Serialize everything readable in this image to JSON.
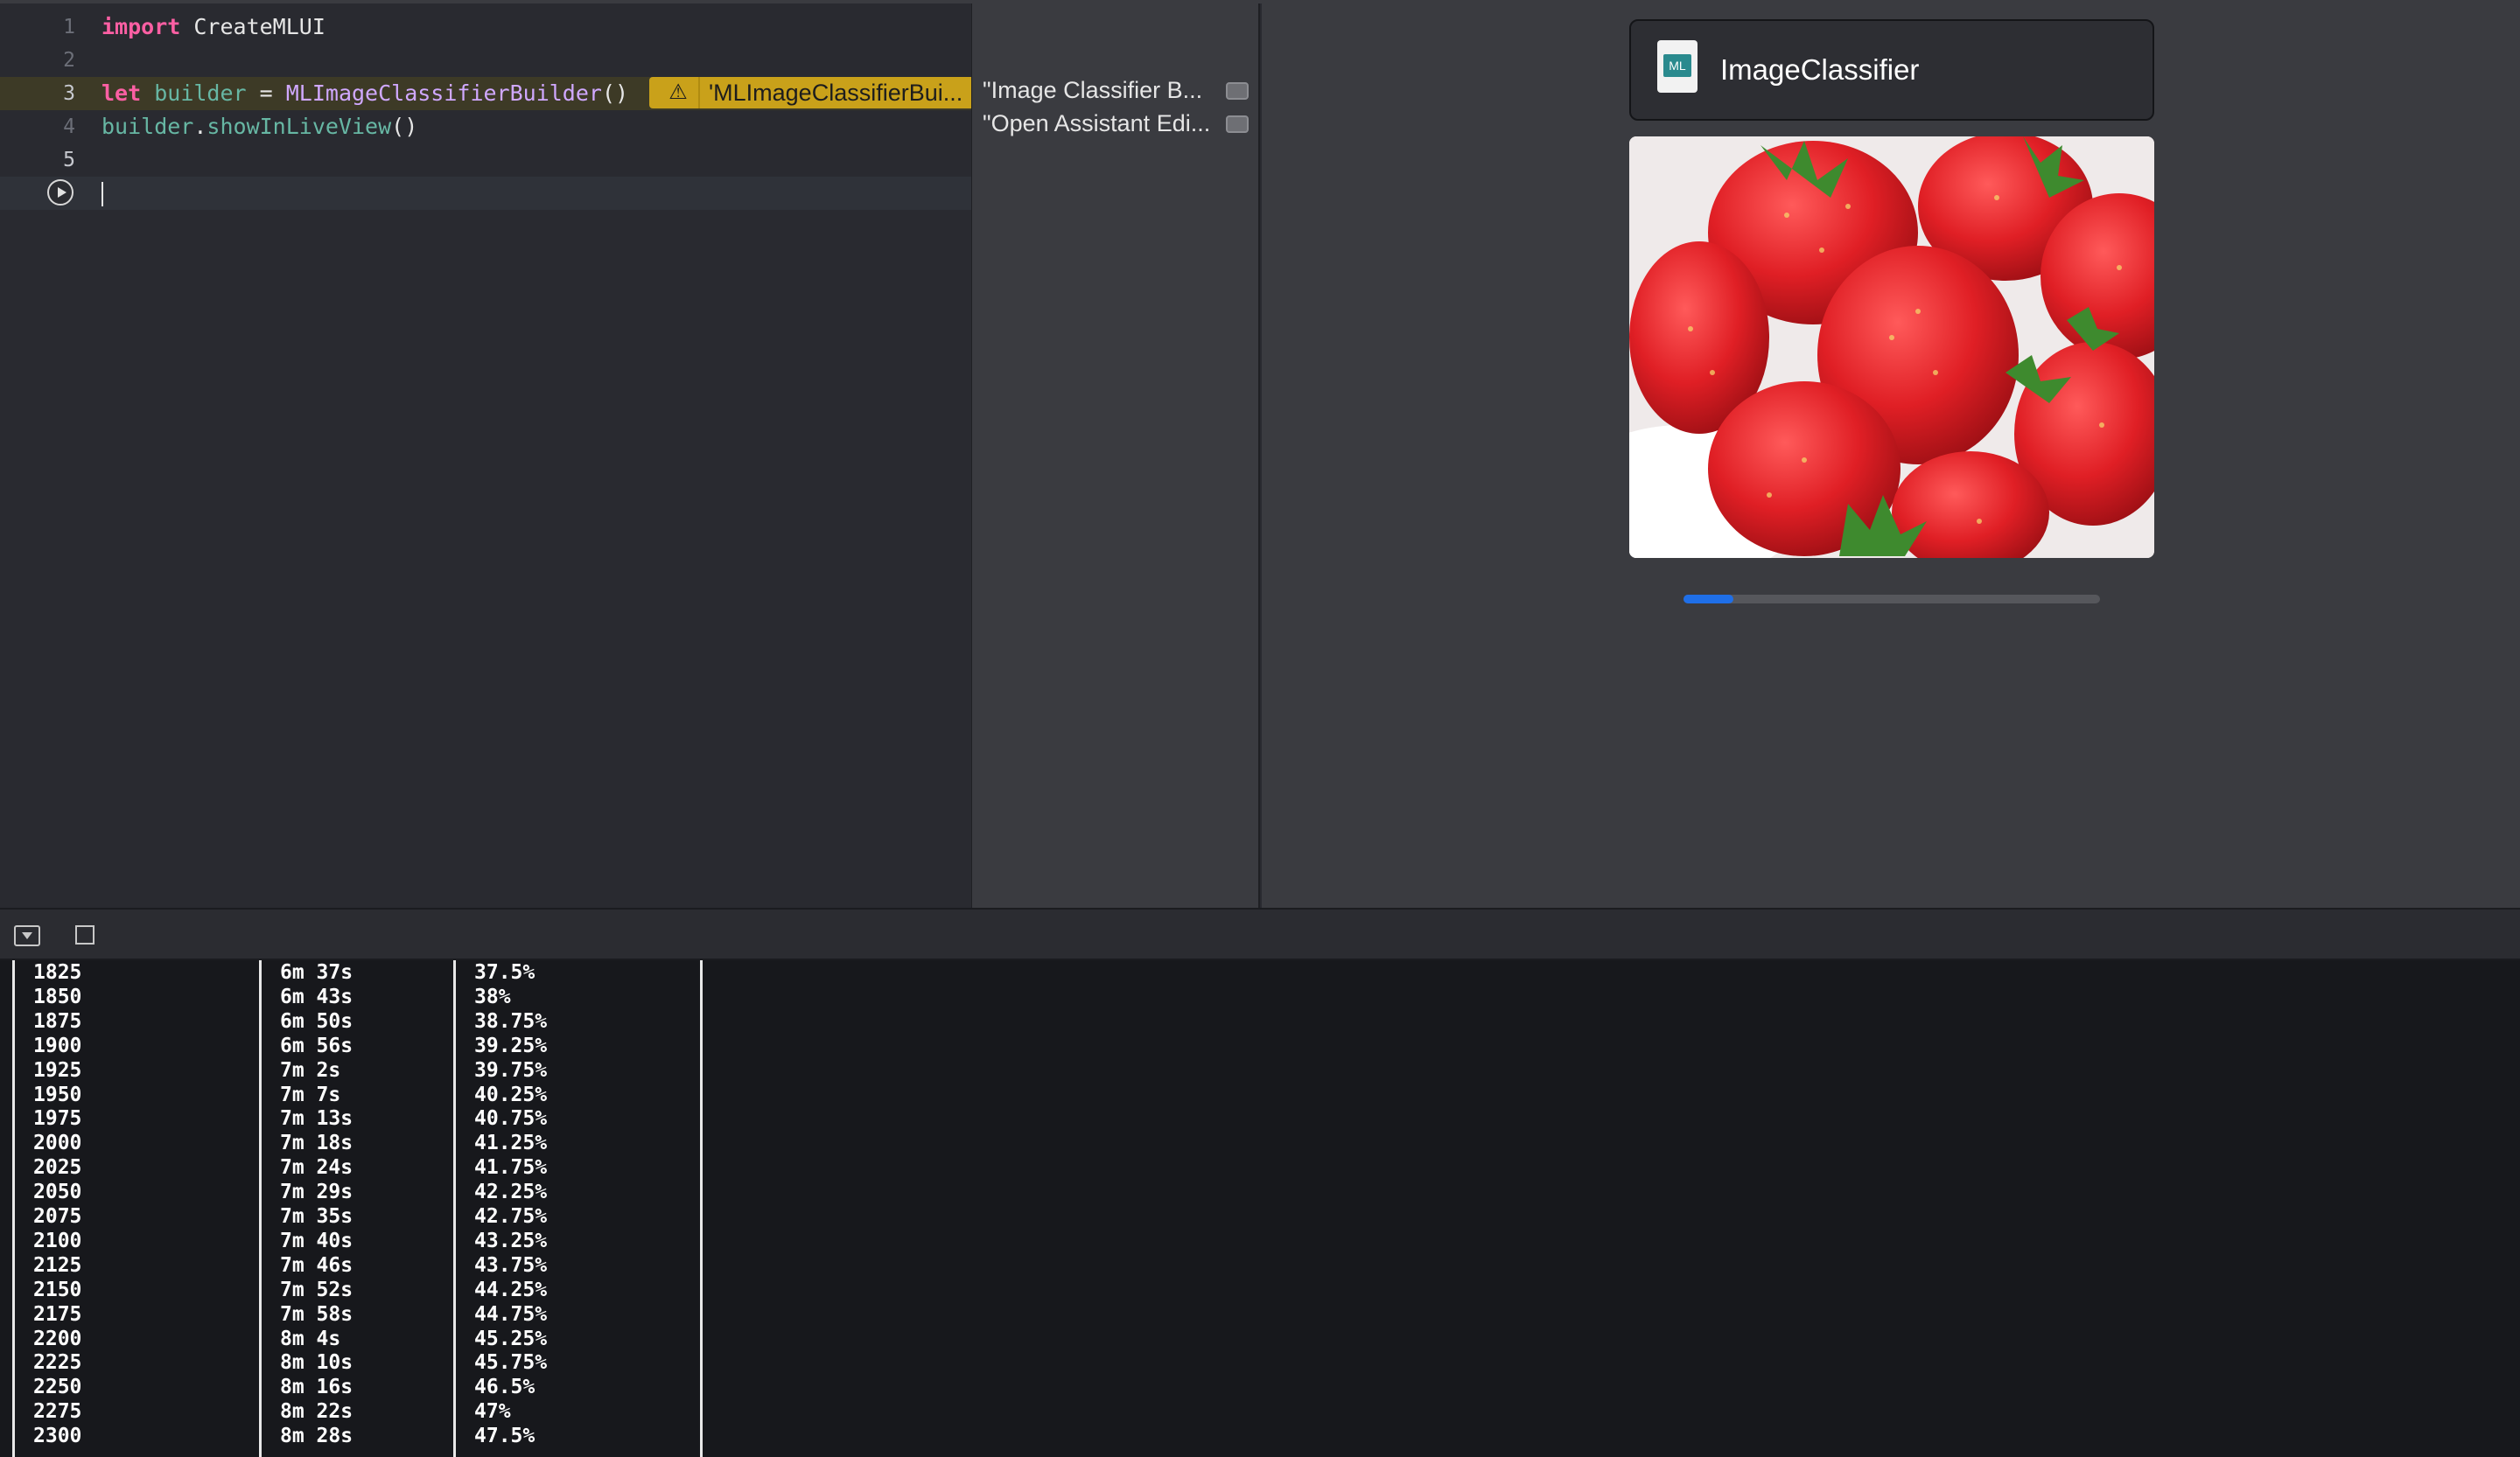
{
  "editor": {
    "lines": [
      {
        "num": "1",
        "keyword": "import",
        "rest": " CreateMLUI"
      },
      {
        "num": "2"
      },
      {
        "num": "3",
        "keyword": "let",
        "var": "builder",
        "op": " = ",
        "type": "MLImageClassifierBuilder",
        "paren": "()"
      },
      {
        "num": "4",
        "obj": "builder",
        "dot": ".",
        "method": "showInLiveView",
        "paren": "()"
      },
      {
        "num": "5"
      }
    ],
    "warning": {
      "icon": "warning-triangle-icon",
      "glyph": "⚠",
      "text": "'MLImageClassifierBui..."
    }
  },
  "results": {
    "items": [
      {
        "text": "\"Image Classifier B...",
        "icon": "quick-look-icon"
      },
      {
        "text": "\"Open Assistant Edi...",
        "icon": "quick-look-icon"
      }
    ]
  },
  "live_view": {
    "title": "ImageClassifier",
    "icon": "mlmodel-document-icon",
    "image_subject": "strawberries",
    "progress": 0.12
  },
  "console": {
    "buttons": {
      "toggle": "hide-debug-area-icon",
      "clear": "console-square-icon"
    },
    "rows": [
      [
        "1825",
        "6m 37s",
        "37.5%"
      ],
      [
        "1850",
        "6m 43s",
        "38%"
      ],
      [
        "1875",
        "6m 50s",
        "38.75%"
      ],
      [
        "1900",
        "6m 56s",
        "39.25%"
      ],
      [
        "1925",
        "7m 2s",
        "39.75%"
      ],
      [
        "1950",
        "7m 7s",
        "40.25%"
      ],
      [
        "1975",
        "7m 13s",
        "40.75%"
      ],
      [
        "2000",
        "7m 18s",
        "41.25%"
      ],
      [
        "2025",
        "7m 24s",
        "41.75%"
      ],
      [
        "2050",
        "7m 29s",
        "42.25%"
      ],
      [
        "2075",
        "7m 35s",
        "42.75%"
      ],
      [
        "2100",
        "7m 40s",
        "43.25%"
      ],
      [
        "2125",
        "7m 46s",
        "43.75%"
      ],
      [
        "2150",
        "7m 52s",
        "44.25%"
      ],
      [
        "2175",
        "7m 58s",
        "44.75%"
      ],
      [
        "2200",
        "8m 4s",
        "45.25%"
      ],
      [
        "2225",
        "8m 10s",
        "45.75%"
      ],
      [
        "2250",
        "8m 16s",
        "46.5%"
      ],
      [
        "2275",
        "8m 22s",
        "47%"
      ],
      [
        "2300",
        "8m 28s",
        "47.5%"
      ]
    ]
  },
  "colors": {
    "accent": "#1f6fe8",
    "warning": "#c9a11a",
    "keyword": "#fc5fa3"
  }
}
